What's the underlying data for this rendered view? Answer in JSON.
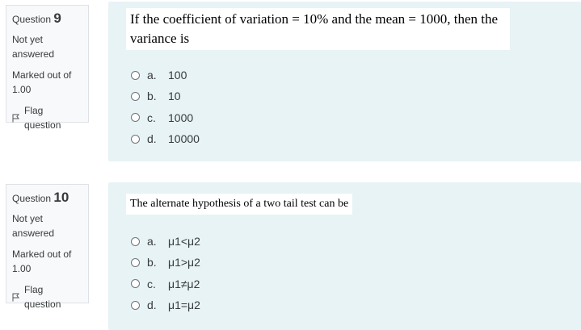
{
  "questions": [
    {
      "info": {
        "label": "Question",
        "number": "9",
        "state": "Not yet answered",
        "grade": "Marked out of 1.00",
        "flag_label": "Flag question"
      },
      "text": "If the coefficient of variation = 10% and the mean = 1000, then the variance is",
      "options": [
        {
          "letter": "a.",
          "value": "100"
        },
        {
          "letter": "b.",
          "value": "10"
        },
        {
          "letter": "c.",
          "value": "1000"
        },
        {
          "letter": "d.",
          "value": "10000"
        }
      ]
    },
    {
      "info": {
        "label": "Question",
        "number": "10",
        "state": "Not yet answered",
        "grade": "Marked out of 1.00",
        "flag_label": "Flag question"
      },
      "text": "The alternate hypothesis of a two tail test can be",
      "options": [
        {
          "letter": "a.",
          "value": "μ1<μ2"
        },
        {
          "letter": "b.",
          "value": "μ1>μ2"
        },
        {
          "letter": "c.",
          "value": "μ1≠μ2"
        },
        {
          "letter": "d.",
          "value": "μ1=μ2"
        }
      ]
    }
  ]
}
